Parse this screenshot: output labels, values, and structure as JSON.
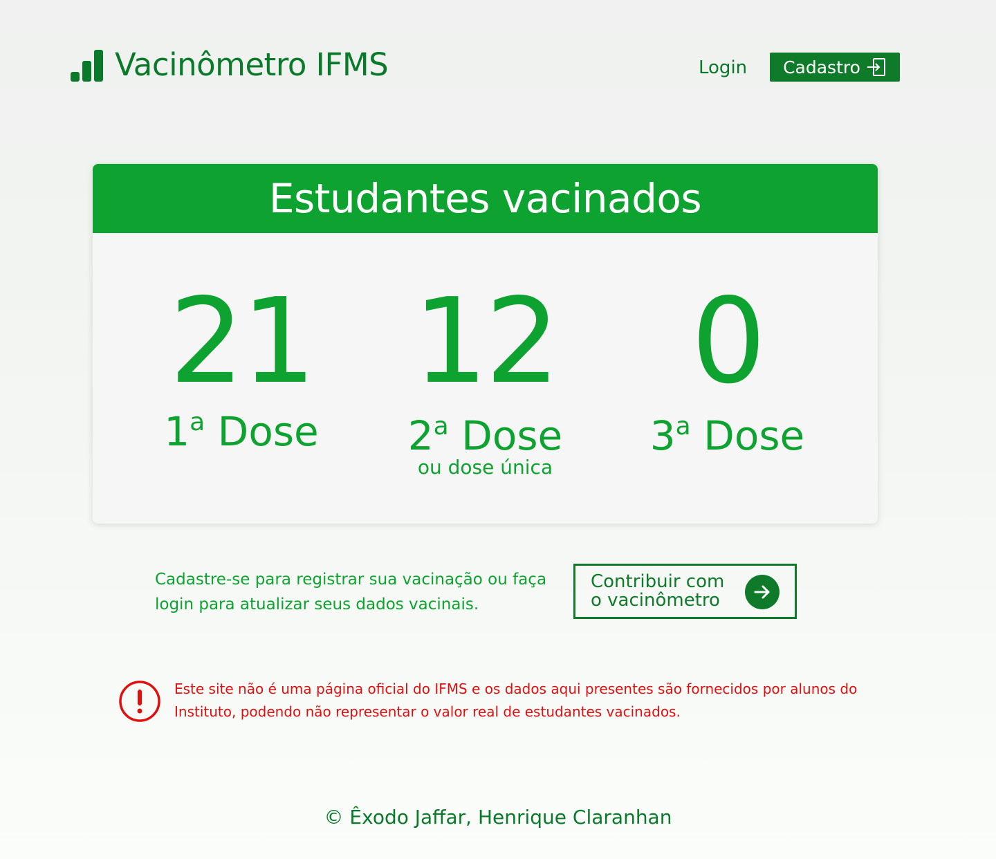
{
  "header": {
    "brand": "Vacinômetro IFMS",
    "brand_icon": "bar-chart-icon",
    "login_label": "Login",
    "signup_label": "Cadastro",
    "signup_icon": "sign-in-icon"
  },
  "card": {
    "title": "Estudantes vacinados",
    "stats": [
      {
        "value": "21",
        "label_num": "1",
        "label_sup": "a",
        "label_word": "Dose",
        "sub": ""
      },
      {
        "value": "12",
        "label_num": "2",
        "label_sup": "a",
        "label_word": "Dose",
        "sub": "ou dose única"
      },
      {
        "value": "0",
        "label_num": "3",
        "label_sup": "a",
        "label_word": "Dose",
        "sub": ""
      }
    ]
  },
  "cta": {
    "text": "Cadastre-se para registrar sua vacinação ou faça login para atualizar seus dados vacinais.",
    "button_label": "Contribuir com o vacinômetro",
    "button_icon": "arrow-right-icon"
  },
  "warning": {
    "icon": "exclamation-circle-icon",
    "text": "Este site não é uma página oficial do IFMS e os dados aqui presentes são fornecidos por alunos do Instituto, podendo não representar o valor real de estudantes vacinados."
  },
  "footer": {
    "credits": "© Êxodo Jaffar, Henrique Claranhan"
  },
  "colors": {
    "brand_dark_green": "#0a7a2a",
    "accent_green": "#0ea330",
    "warning_red": "#e01010"
  }
}
